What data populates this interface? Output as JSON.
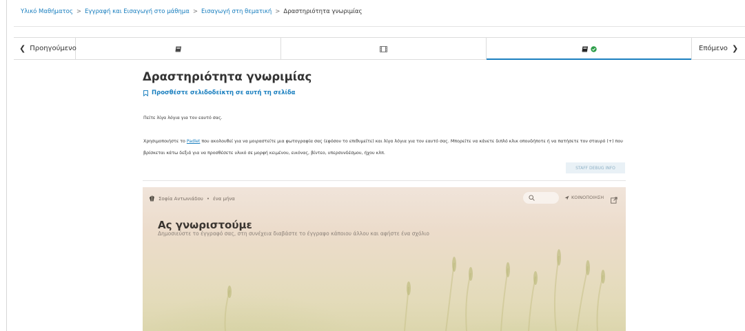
{
  "breadcrumb": {
    "items": [
      "Υλικό Μαθήματος",
      "Εγγραφή και Εισαγωγή στο μάθημα",
      "Εισαγωγή στη θεματική"
    ],
    "separator": ">",
    "current": "Δραστηριότητα γνωριμίας"
  },
  "sequence_nav": {
    "prev_label": "Προηγούμενο",
    "next_label": "Επόμενο",
    "tabs": [
      {
        "icon": "book-icon",
        "active": false
      },
      {
        "icon": "film-icon",
        "active": false
      },
      {
        "icon": "book-check-icon",
        "active": true
      }
    ]
  },
  "page": {
    "title": "Δραστηριότητα γνωριμίας",
    "bookmark_label": "Προσθέστε σελιδοδείκτη σε αυτή τη σελίδα",
    "paragraph1": "Πείτε λίγα λόγια για τον εαυτό σας.",
    "paragraph2_pre": "Χρησιμοποιήστε το ",
    "paragraph2_link": "Padlet",
    "paragraph2_post": " που ακολουθεί για να μοιραστείτε μια φωτογραφία σας (εφόσον το επιθυμείτε) και λίγα λόγια για τον εαυτό σας. Μπορείτε να κάνετε διπλό κλικ οπουδήποτε ή να πατήσετε τον σταυρό (+) που βρίσκεται κάτω δεξιά για να προσθέσετε υλικό σε μορφή κειμένου, εικόνας, βίντεο, υπερσυνδέσμου, ήχου κλπ.",
    "debug_button": "STAFF DEBUG INFO"
  },
  "padlet": {
    "author": "Σοφία Αντωνιάδου",
    "dot": "•",
    "time": "ένα μήνα",
    "share_label": "ΚΟΙΝΟΠΟΙΗΣΗ",
    "title": "Ας γνωριστούμε",
    "subtitle": "Δημοσιεύστε το έγγραφό σας, στη συνέχεια διαβάστε το έγγραφο κάποιου άλλου και αφήστε ένα σχόλιο"
  },
  "colors": {
    "link": "#1a7fbf",
    "active_tab": "#1a7fbf",
    "check_green": "#2e9e4a"
  }
}
